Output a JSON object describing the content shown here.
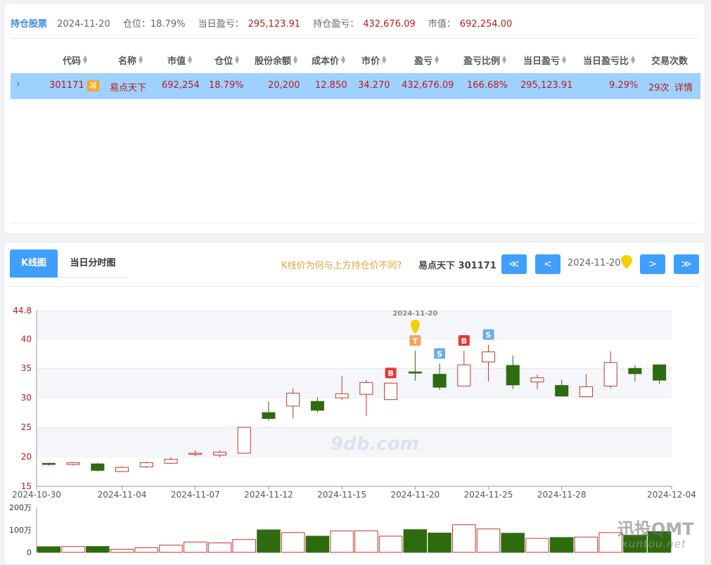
{
  "summary": {
    "title": "持仓股票",
    "date": "2024-11-20",
    "position_label": "仓位：",
    "position_value": "18.79%",
    "day_pnl_label": "当日盈亏：",
    "day_pnl_value": "295,123.91",
    "hold_pnl_label": "持仓盈亏：",
    "hold_pnl_value": "432,676.09",
    "market_value_label": "市值：",
    "market_value_value": "692,254.00"
  },
  "table": {
    "headers": [
      "代码",
      "名称",
      "市值",
      "仓位",
      "股份余额",
      "成本价",
      "市价",
      "盈亏",
      "盈亏比例",
      "当日盈亏",
      "当日盈亏比",
      "交易次数"
    ],
    "row": {
      "code": "301171",
      "badge": "减",
      "name": "易点天下",
      "market_value": "692,254",
      "position": "18.79%",
      "shares": "20,200",
      "cost": "12.850",
      "price": "34.270",
      "pnl": "432,676.09",
      "pnl_ratio": "166.68%",
      "day_pnl": "295,123.91",
      "day_pnl_ratio": "9.29%",
      "trades": "29次",
      "detail": "详情"
    }
  },
  "chart_panel": {
    "tab_kline": "K线图",
    "tab_intraday": "当日分时图",
    "question": "K线价为何与上方持仓价不同?",
    "stock": "易点天下 301171",
    "first_btn": "≪",
    "prev_btn": "<",
    "current_date": "2024-11-20",
    "next_btn": ">",
    "last_btn": "≫"
  },
  "watermark": {
    "brand": "迅投QMT",
    "site": "xuntou.net",
    "chart_mark": "9db.com"
  },
  "chart_data": {
    "type": "candlestick",
    "ylim": [
      15,
      44.8
    ],
    "y_ticks": [
      15,
      20,
      25,
      30,
      35,
      40,
      44.8
    ],
    "x_tick_labels": [
      "2024-10-30",
      "2024-11-04",
      "2024-11-07",
      "2024-11-12",
      "2024-11-15",
      "2024-11-20",
      "2024-11-25",
      "2024-11-28",
      "2024-12-04"
    ],
    "marker_label": "2024-11-20",
    "colors": {
      "up": "#c0392b",
      "down": "#2e6b0f"
    },
    "candles": [
      {
        "o": 18.9,
        "c": 18.7,
        "h": 19.0,
        "l": 18.5
      },
      {
        "o": 18.7,
        "c": 19.0,
        "h": 19.1,
        "l": 18.5
      },
      {
        "o": 18.8,
        "c": 17.7,
        "h": 19.0,
        "l": 17.5
      },
      {
        "o": 17.5,
        "c": 18.2,
        "h": 18.4,
        "l": 17.5
      },
      {
        "o": 18.3,
        "c": 19.0,
        "h": 19.2,
        "l": 18.1
      },
      {
        "o": 18.9,
        "c": 19.6,
        "h": 19.9,
        "l": 18.8
      },
      {
        "o": 20.4,
        "c": 20.6,
        "h": 21.1,
        "l": 20.1
      },
      {
        "o": 20.3,
        "c": 20.8,
        "h": 21.1,
        "l": 19.9
      },
      {
        "o": 20.6,
        "c": 25.0,
        "h": 25.0,
        "l": 20.6
      },
      {
        "o": 27.5,
        "c": 26.5,
        "h": 29.4,
        "l": 26.1
      },
      {
        "o": 28.6,
        "c": 30.8,
        "h": 31.6,
        "l": 26.5
      },
      {
        "o": 29.4,
        "c": 27.9,
        "h": 30.1,
        "l": 27.5
      },
      {
        "o": 30.0,
        "c": 30.7,
        "h": 33.7,
        "l": 29.6
      },
      {
        "o": 30.6,
        "c": 32.6,
        "h": 33.0,
        "l": 26.9
      },
      {
        "o": 29.7,
        "c": 32.5,
        "h": 32.5,
        "l": 29.6
      },
      {
        "o": 34.4,
        "c": 34.2,
        "h": 38.0,
        "l": 32.9
      },
      {
        "o": 34.0,
        "c": 31.8,
        "h": 35.8,
        "l": 31.4
      },
      {
        "o": 32.0,
        "c": 35.6,
        "h": 38.0,
        "l": 32.0
      },
      {
        "o": 36.1,
        "c": 37.8,
        "h": 39.0,
        "l": 32.8
      },
      {
        "o": 35.5,
        "c": 32.2,
        "h": 37.2,
        "l": 31.5
      },
      {
        "o": 32.7,
        "c": 33.4,
        "h": 33.9,
        "l": 31.5
      },
      {
        "o": 32.1,
        "c": 30.3,
        "h": 33.1,
        "l": 30.2
      },
      {
        "o": 30.2,
        "c": 31.9,
        "h": 34.0,
        "l": 30.1
      },
      {
        "o": 32.0,
        "c": 36.0,
        "h": 37.9,
        "l": 31.6
      },
      {
        "o": 35.0,
        "c": 34.1,
        "h": 35.6,
        "l": 32.8
      },
      {
        "o": 35.6,
        "c": 33.0,
        "h": 35.6,
        "l": 32.3
      }
    ],
    "tick_candle_index": [
      0,
      3,
      6,
      9,
      12,
      15,
      18,
      21,
      25
    ],
    "signals": [
      {
        "candle": 14,
        "label": "B",
        "color": "#e53935"
      },
      {
        "candle": 15,
        "label": "T",
        "color": "#f0a35e"
      },
      {
        "candle": 16,
        "label": "S",
        "color": "#6aaee8"
      },
      {
        "candle": 17,
        "label": "B",
        "color": "#e53935"
      },
      {
        "candle": 18,
        "label": "S",
        "color": "#6aaee8"
      }
    ],
    "volume": {
      "y_ticks": [
        "200万",
        "100万",
        "0"
      ],
      "max": 200,
      "values": [
        25,
        26,
        26,
        14,
        21,
        32,
        46,
        42,
        57,
        100,
        88,
        72,
        95,
        96,
        72,
        101,
        86,
        123,
        104,
        85,
        62,
        66,
        68,
        88,
        76,
        92
      ]
    }
  }
}
